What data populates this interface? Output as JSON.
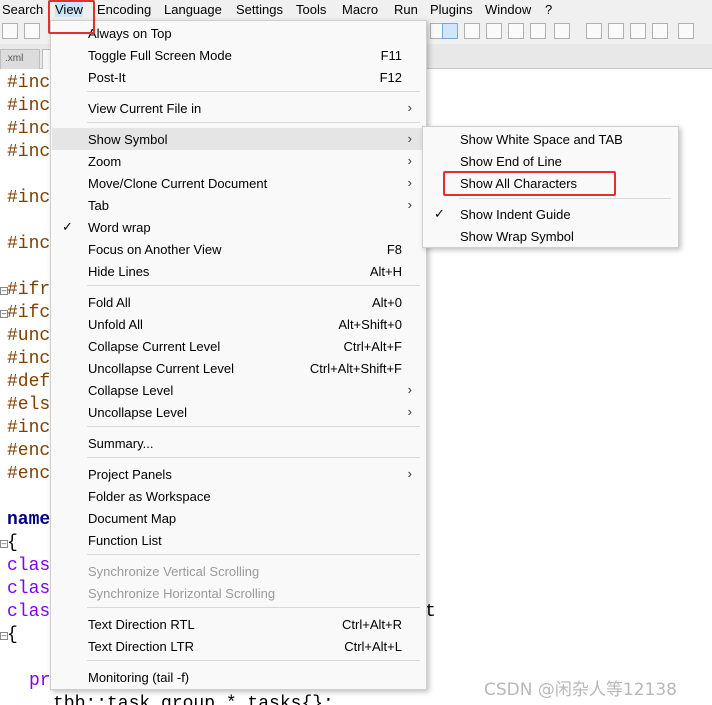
{
  "menubar": {
    "items": [
      "Search",
      "View",
      "Encoding",
      "Language",
      "Settings",
      "Tools",
      "Macro",
      "Run",
      "Plugins",
      "Window",
      "?"
    ]
  },
  "tabs": {
    "first_label": ".xml"
  },
  "editor": {
    "lines": [
      "#inc",
      "#inc",
      "#inc",
      "#inc",
      "#inc",
      "#inc",
      "#ifr",
      "#ifc",
      "#unc",
      "#inc",
      "#def",
      "#els",
      "#inc",
      "#enc",
      "#enc",
      "name",
      "{",
      "clas",
      "clas",
      "clas",
      "t",
      "{",
      "pr",
      "tbb::task_group * tasks{};"
    ]
  },
  "view_menu": {
    "always_on_top": "Always on Top",
    "toggle_full_screen": "Toggle Full Screen Mode",
    "toggle_full_screen_shortcut": "F11",
    "post_it": "Post-It",
    "post_it_shortcut": "F12",
    "view_current_file_in": "View Current File in",
    "show_symbol": "Show Symbol",
    "zoom": "Zoom",
    "move_clone": "Move/Clone Current Document",
    "tab": "Tab",
    "word_wrap": "Word wrap",
    "focus_other_view": "Focus on Another View",
    "focus_other_view_shortcut": "F8",
    "hide_lines": "Hide Lines",
    "hide_lines_shortcut": "Alt+H",
    "fold_all": "Fold All",
    "fold_all_shortcut": "Alt+0",
    "unfold_all": "Unfold All",
    "unfold_all_shortcut": "Alt+Shift+0",
    "collapse_current": "Collapse Current Level",
    "collapse_current_shortcut": "Ctrl+Alt+F",
    "uncollapse_current": "Uncollapse Current Level",
    "uncollapse_current_shortcut": "Ctrl+Alt+Shift+F",
    "collapse_level": "Collapse Level",
    "uncollapse_level": "Uncollapse Level",
    "summary": "Summary...",
    "project_panels": "Project Panels",
    "folder_as_workspace": "Folder as Workspace",
    "document_map": "Document Map",
    "function_list": "Function List",
    "sync_vertical": "Synchronize Vertical Scrolling",
    "sync_horizontal": "Synchronize Horizontal Scrolling",
    "text_dir_rtl": "Text Direction RTL",
    "text_dir_rtl_shortcut": "Ctrl+Alt+R",
    "text_dir_ltr": "Text Direction LTR",
    "text_dir_ltr_shortcut": "Ctrl+Alt+L",
    "monitoring": "Monitoring (tail -f)"
  },
  "show_symbol_submenu": {
    "white_space_tab": "Show White Space and TAB",
    "end_of_line": "Show End of Line",
    "all_characters": "Show All Characters",
    "indent_guide": "Show Indent Guide",
    "wrap_symbol": "Show Wrap Symbol"
  },
  "glyphs": {
    "arrow": "›",
    "check": "✓",
    "fold_minus": "−"
  },
  "watermark": "CSDN @闲杂人等12138",
  "colors": {
    "highlight_box": "#e03030",
    "preprocessor": "#804000",
    "keyword": "#000080",
    "type": "#8000ff"
  }
}
